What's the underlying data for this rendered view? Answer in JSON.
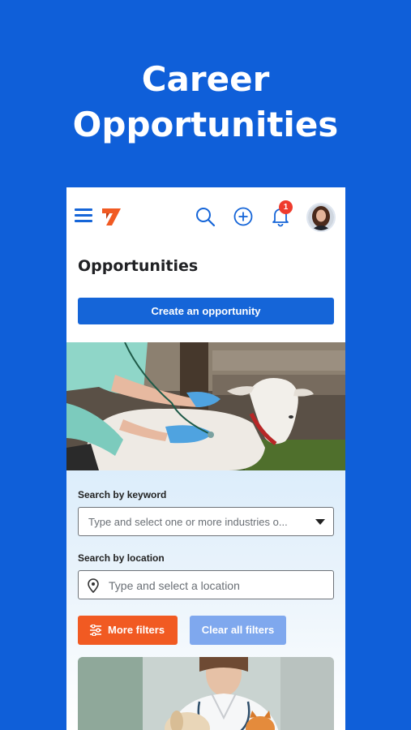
{
  "hero": {
    "line1": "Career",
    "line2": "Opportunities"
  },
  "header": {
    "notification_count": "1"
  },
  "page": {
    "title": "Opportunities",
    "create_button": "Create an opportunity"
  },
  "filters": {
    "keyword_label": "Search by keyword",
    "keyword_placeholder": "Type and select one or more industries o...",
    "location_label": "Search by location",
    "location_placeholder": "Type and select a location",
    "more_filters": "More filters",
    "clear_filters": "Clear all filters"
  },
  "colors": {
    "background": "#0f5fd9",
    "primary": "#1565d8",
    "accent": "#f15a22",
    "badge": "#ef3b2d",
    "clear_button": "#7fa8ee"
  },
  "icons": [
    "menu-icon",
    "app-logo",
    "search-icon",
    "add-circle-icon",
    "bell-icon",
    "location-pin-icon",
    "sliders-icon",
    "dropdown-caret-icon"
  ]
}
